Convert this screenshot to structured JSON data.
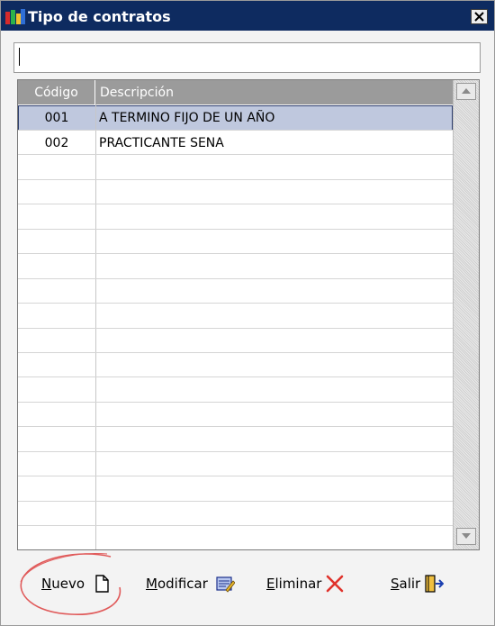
{
  "window": {
    "title": "Tipo de contratos"
  },
  "search": {
    "value": ""
  },
  "grid": {
    "columns": {
      "code": "Código",
      "description": "Descripción"
    },
    "rows": [
      {
        "code": "001",
        "description": "A TERMINO FIJO DE UN AÑO",
        "selected": true
      },
      {
        "code": "002",
        "description": "PRACTICANTE SENA",
        "selected": false
      }
    ]
  },
  "buttons": {
    "nuevo": "Nuevo",
    "modificar": "Modificar",
    "eliminar": "Eliminar",
    "salir": "Salir"
  },
  "icons": {
    "app": "app-icon",
    "close": "close-icon",
    "nuevo": "new-document-icon",
    "modificar": "edit-icon",
    "eliminar": "delete-x-icon",
    "salir": "exit-door-icon"
  },
  "colors": {
    "titlebar": "#0e2b60",
    "header": "#9b9b9b",
    "selection": "#bfc8de",
    "delete": "#e0322b",
    "annotation": "#e05a5a"
  }
}
